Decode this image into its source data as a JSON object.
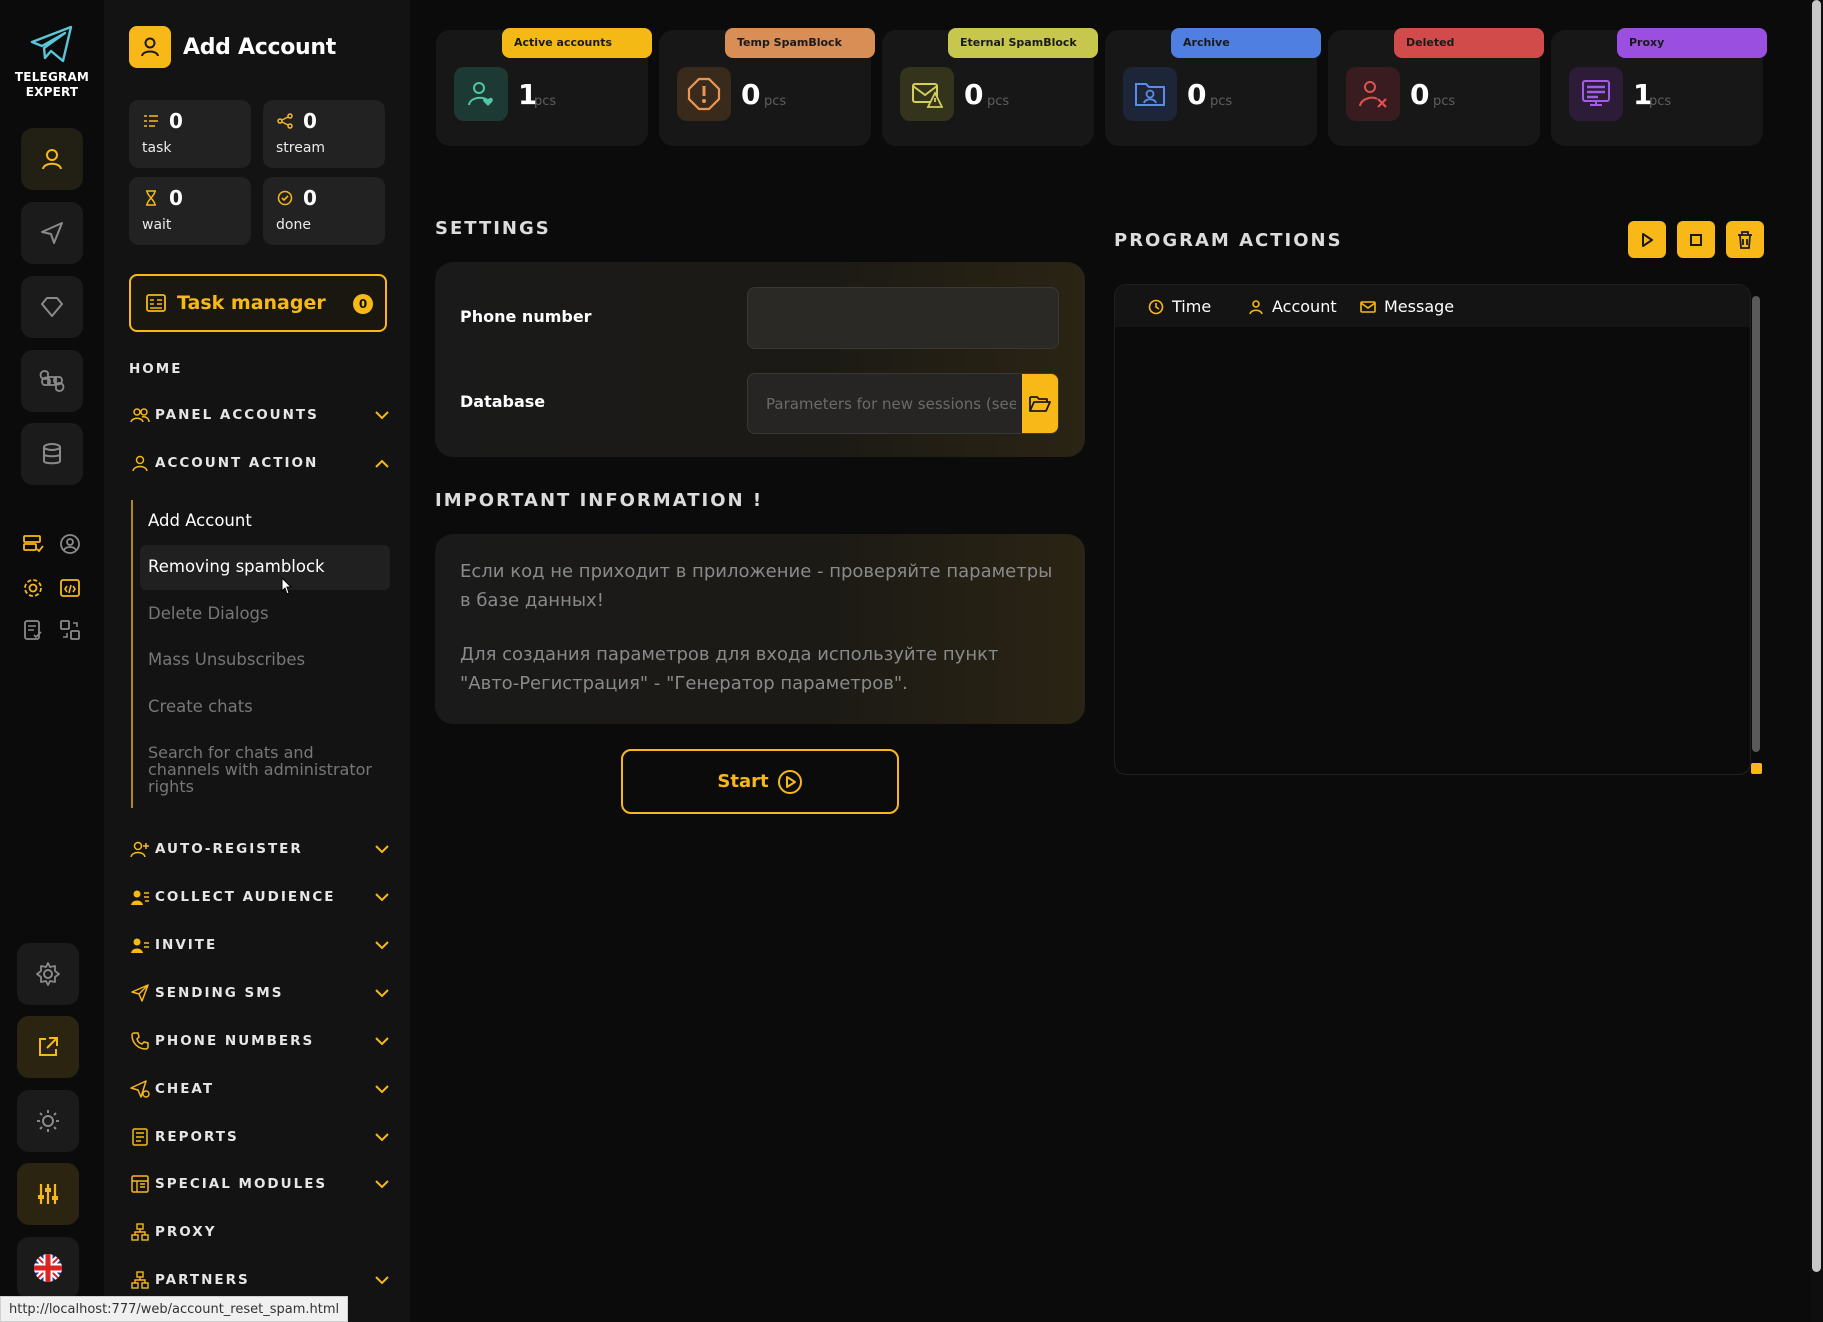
{
  "app": {
    "logo_line1": "TELEGRAM",
    "logo_line2": "EXPERT"
  },
  "colors": {
    "accent": "#f8b918",
    "background": "#0b0b0b",
    "sidebar": "#131313",
    "active_badge": "#f5b915",
    "temp_badge": "#d88e55",
    "eternal_badge": "#c7c74e",
    "archive_badge": "#4f7fe0",
    "deleted_badge": "#d14b4b",
    "proxy_badge": "#9b4fe0"
  },
  "sidebar": {
    "title": "Add Account",
    "stats": [
      {
        "value": "0",
        "label": "task",
        "icon": "task-list-icon"
      },
      {
        "value": "0",
        "label": "stream",
        "icon": "share-nodes-icon"
      },
      {
        "value": "0",
        "label": "wait",
        "icon": "hourglass-icon"
      },
      {
        "value": "0",
        "label": "done",
        "icon": "check-circle-icon"
      }
    ],
    "task_manager": {
      "label": "Task manager",
      "count": "0"
    },
    "home": "HOME",
    "sections": {
      "panel_accounts": "PANEL ACCOUNTS",
      "account_action": "ACCOUNT ACTION",
      "auto_register": "AUTO-REGISTER",
      "collect_audience": "COLLECT AUDIENCE",
      "invite": "INVITE",
      "sending_sms": "SENDING SMS",
      "phone_numbers": "PHONE NUMBERS",
      "cheat": "CHEAT",
      "reports": "REPORTS",
      "special_modules": "SPECIAL MODULES",
      "proxy": "PROXY",
      "partners": "PARTNERS"
    },
    "account_action_items": [
      "Add Account",
      "Removing spamblock",
      "Delete Dialogs",
      "Mass Unsubscribes",
      "Create chats",
      "Search for chats and channels with administrator rights"
    ]
  },
  "status_cards": [
    {
      "badge": "Active accounts",
      "value": "1",
      "unit": "pcs",
      "icon": "user-heart-icon"
    },
    {
      "badge": "Temp SpamBlock",
      "value": "0",
      "unit": "pcs",
      "icon": "warning-circle-icon"
    },
    {
      "badge": "Eternal SpamBlock",
      "value": "0",
      "unit": "pcs",
      "icon": "mail-warning-icon"
    },
    {
      "badge": "Archive",
      "value": "0",
      "unit": "pcs",
      "icon": "folder-user-icon"
    },
    {
      "badge": "Deleted",
      "value": "0",
      "unit": "pcs",
      "icon": "user-remove-icon"
    },
    {
      "badge": "Proxy",
      "value": "1",
      "unit": "pcs",
      "icon": "proxy-server-icon"
    }
  ],
  "settings": {
    "title": "SETTINGS",
    "phone_label": "Phone number",
    "phone_value": "",
    "database_label": "Database",
    "database_placeholder": "Parameters for new sessions (see po"
  },
  "info": {
    "title": "IMPORTANT INFORMATION !",
    "p1": "Если код не приходит в приложение - проверяйте параметры в базе данных!",
    "p2": "Для создания параметров для входа используйте пункт \"Авто-Регистрация\" - \"Генератор параметров\"."
  },
  "start_button": "Start",
  "program_actions": {
    "title": "PROGRAM ACTIONS",
    "columns": [
      "Time",
      "Account",
      "Message"
    ],
    "rows": []
  },
  "status_url": "http://localhost:777/web/account_reset_spam.html"
}
